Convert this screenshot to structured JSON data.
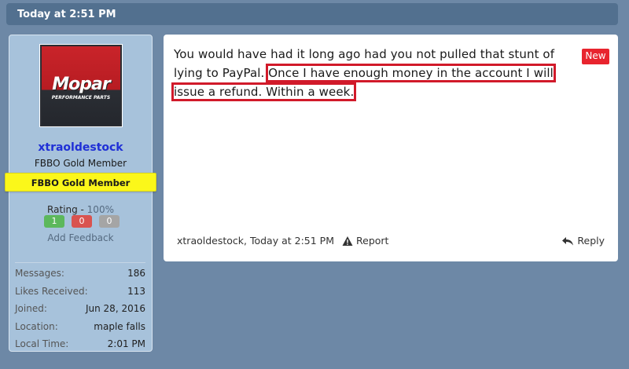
{
  "date_bar": {
    "label": "Today at 2:51 PM"
  },
  "user": {
    "avatar_logo": "Mopar",
    "avatar_sub": "PERFORMANCE PARTS",
    "username": "xtraoldestock",
    "title": "FBBO Gold Member",
    "banner": "FBBO Gold Member",
    "rating_label": "Rating - ",
    "rating_pct": "100%",
    "rating_pos": "1",
    "rating_neg": "0",
    "rating_neu": "0",
    "add_feedback": "Add Feedback",
    "stats": [
      {
        "key": "Messages:",
        "value": "186"
      },
      {
        "key": "Likes Received:",
        "value": "113"
      },
      {
        "key": "Joined:",
        "value": "Jun 28, 2016"
      },
      {
        "key": "Location:",
        "value": "maple falls"
      },
      {
        "key": "Local Time:",
        "value": "2:01 PM"
      }
    ]
  },
  "post": {
    "text_plain": "You would have had it long ago had you not pulled that stunt of lying to PayPal.",
    "text_highlight_1": "Once I have enough money in the account I will",
    "text_highlight_2": "issue a refund. Within a week.",
    "new_badge": "New",
    "footer_author_time": "xtraoldestock, Today at 2:51 PM",
    "report_label": "Report",
    "reply_label": "Reply"
  },
  "colors": {
    "page_bg": "#6d88a6",
    "date_bar_bg": "#52708f",
    "sidebar_bg": "#a7c2db",
    "username": "#1f2fd6",
    "banner_bg": "#fbf71a",
    "highlight_outline": "#d11a2a",
    "new_badge_bg": "#e8242e"
  },
  "icons": {
    "report": "warning-triangle-icon",
    "reply": "reply-arrow-icon"
  }
}
